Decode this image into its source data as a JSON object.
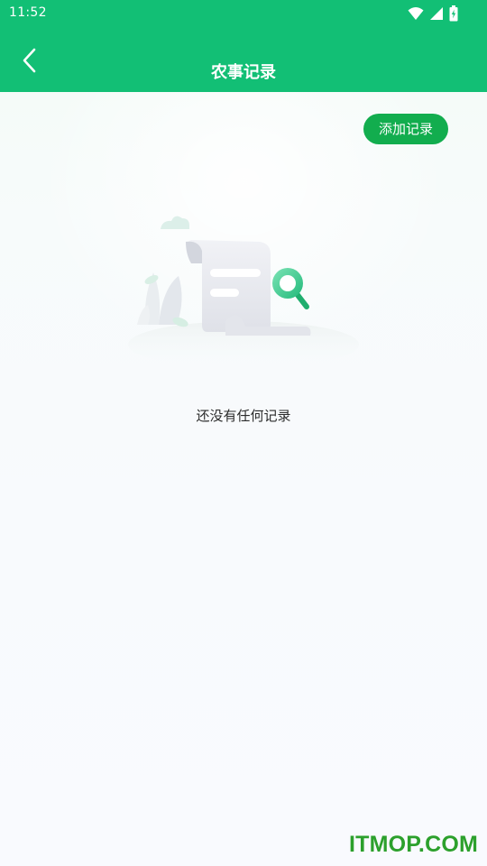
{
  "status_bar": {
    "time": "11:52",
    "icons": [
      "wifi-icon",
      "signal-icon",
      "battery-charging-icon"
    ]
  },
  "app_bar": {
    "title": "农事记录",
    "back_icon": "chevron-left-icon",
    "color": "#12bf75"
  },
  "main": {
    "add_button_label": "添加记录",
    "add_button_color": "#12ad4e",
    "empty_illustration": "empty-records-illustration",
    "empty_message": "还没有任何记录"
  },
  "watermark": {
    "text": "ITMOP.COM",
    "color": "#2ca02c"
  }
}
